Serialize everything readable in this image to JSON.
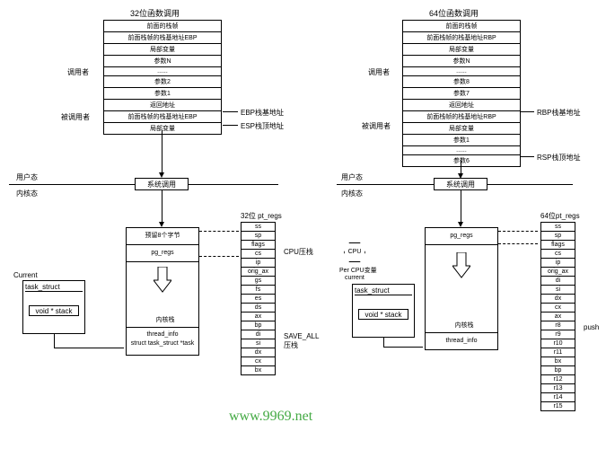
{
  "left": {
    "title": "32位函数调用",
    "frame_top": "前面的栈帧",
    "rows": [
      "前面栈帧的栈基地址EBP",
      "局部变量",
      "参数N",
      "......",
      "参数2",
      "参数1",
      "返回地址",
      "前面栈帧的栈基地址EBP",
      "局部变量"
    ],
    "lbl_caller": "调用者",
    "lbl_callee": "被调用者",
    "ptr1": "EBP栈基地址",
    "ptr2": "ESP栈顶地址",
    "syscall": "系统调用",
    "userland": "用户态",
    "kernel": "内核态",
    "reserve": "预留8个字节",
    "pg": "pg_regs",
    "kstack": "内核栈",
    "thread": "thread_info\nstruct task_struct *task",
    "ptregs_title": "32位 pt_regs",
    "pt_regs": [
      "ss",
      "sp",
      "flags",
      "cs",
      "ip",
      "orig_ax",
      "gs",
      "fs",
      "es",
      "ds",
      "ax",
      "bp",
      "di",
      "si",
      "dx",
      "cx",
      "bx"
    ],
    "cpu_push": "CPU压栈",
    "save_all": "SAVE_ALL\n压栈",
    "current": "Current",
    "task_struct": "task_struct",
    "void_stack": "void * stack"
  },
  "right": {
    "title": "64位函数调用",
    "frame_top": "前面的栈帧",
    "rows": [
      "前面栈帧的栈基地址RBP",
      "局部变量",
      "参数N",
      "......",
      "参数8",
      "参数7",
      "返回地址",
      "前面栈帧的栈基地址RBP",
      "局部变量",
      "参数1",
      "......",
      "参数6"
    ],
    "lbl_caller": "调用者",
    "lbl_callee": "被调用者",
    "ptr1": "RBP栈基地址",
    "ptr2": "RSP栈顶地址",
    "syscall": "系统调用",
    "userland": "用户态",
    "kernel": "内核态",
    "pg": "pg_regs",
    "kstack": "内核栈",
    "thread": "thread_info",
    "ptregs_title": "64位pt_regs",
    "pt_regs": [
      "ss",
      "sp",
      "flags",
      "cs",
      "ip",
      "orig_ax",
      "di",
      "si",
      "dx",
      "cx",
      "ax",
      "r8",
      "r9",
      "r10",
      "r11",
      "bx",
      "bp",
      "r12",
      "r13",
      "r14",
      "r15"
    ],
    "push": "push",
    "cpu": "CPU",
    "per_cpu": "Per CPU变量",
    "current": "current",
    "task_struct": "task_struct",
    "void_stack": "void * stack"
  },
  "watermark": "www.9969.net"
}
